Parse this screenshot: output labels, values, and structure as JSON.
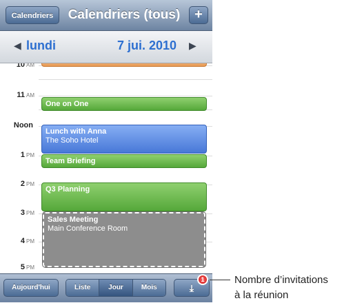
{
  "navbar": {
    "calendars_button": "Calendriers",
    "title": "Calendriers (tous)",
    "add_button": "+"
  },
  "datebar": {
    "prev_glyph": "◀",
    "day": "lundi",
    "date": "7 jui. 2010",
    "next_glyph": "▶"
  },
  "hours": [
    {
      "label": "10",
      "suffix": "AM"
    },
    {
      "label": "11",
      "suffix": "AM"
    },
    {
      "label": "Noon",
      "suffix": ""
    },
    {
      "label": "1",
      "suffix": "PM"
    },
    {
      "label": "2",
      "suffix": "PM"
    },
    {
      "label": "3",
      "suffix": "PM"
    },
    {
      "label": "4",
      "suffix": "PM"
    },
    {
      "label": "5",
      "suffix": "PM"
    }
  ],
  "events": [
    {
      "title": "",
      "location": "",
      "color": "orange"
    },
    {
      "title": "One on One",
      "location": "",
      "color": "green"
    },
    {
      "title": "Lunch with Anna",
      "location": "The Soho Hotel",
      "color": "blue"
    },
    {
      "title": "Team Briefing",
      "location": "",
      "color": "green"
    },
    {
      "title": "Q3 Planning",
      "location": "",
      "color": "green"
    },
    {
      "title": "Sales Meeting",
      "location": "Main Conference Room",
      "color": "gray"
    }
  ],
  "toolbar": {
    "today": "Aujourd'hui",
    "views": [
      "Liste",
      "Jour",
      "Mois"
    ],
    "active_view": "Jour",
    "inbox_icon": "download-icon",
    "badge": "1"
  },
  "callout": {
    "line1": "Nombre d’invitations",
    "line2": "à la réunion"
  },
  "colors": {
    "accent": "#2d6fd0",
    "event_green": "#55a83a",
    "event_blue": "#4878d8",
    "event_orange": "#e79a55",
    "event_gray": "#8d8d8d",
    "badge": "#c81010"
  }
}
